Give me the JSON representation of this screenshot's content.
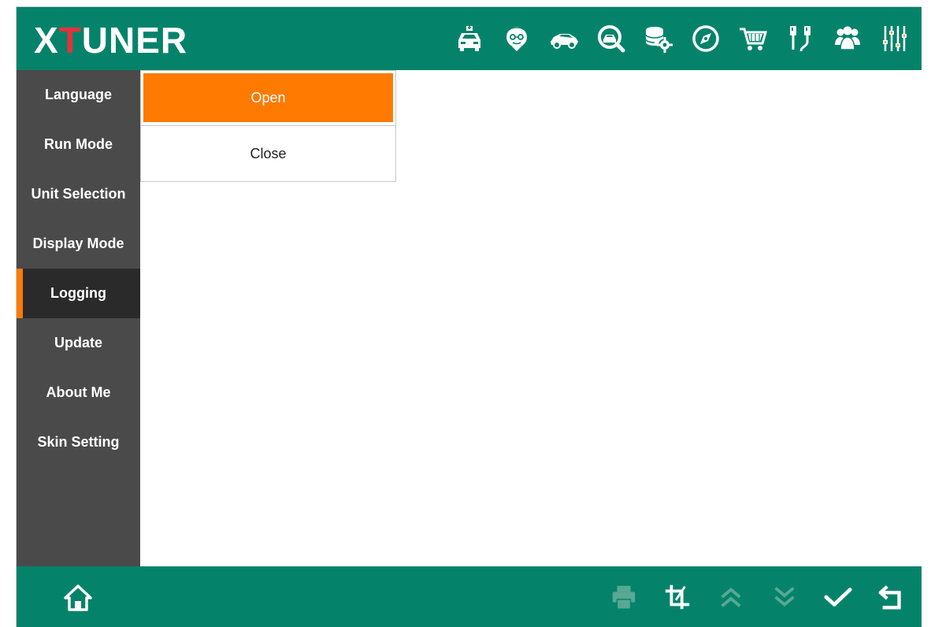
{
  "app": {
    "logo_text_1": "X",
    "logo_text_2": "T",
    "logo_text_3": "UNER",
    "accent_color": "#05836a",
    "highlight_color": "#ff7a00",
    "logo_t_color": "#e5323b"
  },
  "topbar": {
    "icons": [
      "car-diagnosis-icon",
      "doctor-icon",
      "sports-car-icon",
      "search-car-icon",
      "database-settings-icon",
      "compass-icon",
      "shopping-cart-icon",
      "connection-cable-icon",
      "users-group-icon",
      "equalizer-settings-icon"
    ]
  },
  "sidebar": {
    "items": [
      {
        "label": "Language"
      },
      {
        "label": "Run Mode"
      },
      {
        "label": "Unit Selection"
      },
      {
        "label": "Display Mode"
      },
      {
        "label": "Logging",
        "active": true
      },
      {
        "label": "Update"
      },
      {
        "label": "About Me"
      },
      {
        "label": "Skin Setting"
      }
    ]
  },
  "menu": {
    "open_label": "Open",
    "close_label": "Close",
    "selected": "Open"
  },
  "bottombar": {
    "icons": [
      "home-icon",
      "print-icon",
      "crop-icon",
      "page-up-icon",
      "page-down-icon",
      "confirm-icon",
      "back-icon"
    ]
  }
}
